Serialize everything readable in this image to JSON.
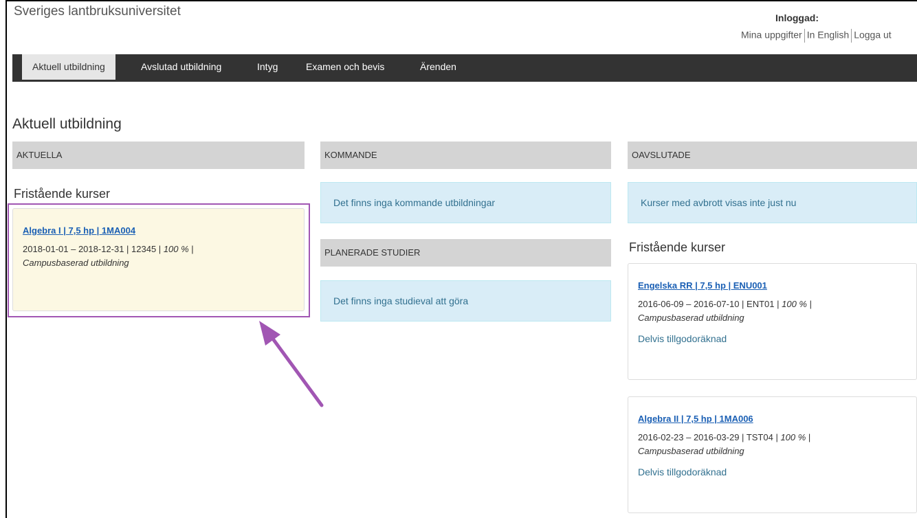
{
  "header": {
    "site_name": "Sveriges lantbruksuniversitet",
    "login_label": "Inloggad:",
    "links": [
      "Mina uppgifter",
      "In English",
      "Logga ut"
    ]
  },
  "nav": {
    "items": [
      {
        "label": "Aktuell utbildning",
        "active": true
      },
      {
        "label": "Avslutad utbildning",
        "active": false
      },
      {
        "label": "Intyg",
        "active": false
      },
      {
        "label": "Examen och bevis",
        "active": false
      },
      {
        "label": "Ärenden",
        "active": false
      }
    ]
  },
  "page": {
    "title": "Aktuell utbildning"
  },
  "columns": {
    "aktuella": {
      "header": "AKTUELLA",
      "section": "Fristående kurser",
      "courses": [
        {
          "title": "Algebra I | 7,5 hp | 1MA004",
          "meta_plain": "2018-01-01 – 2018-12-31 | 12345 | ",
          "pace": "100 %",
          "form": "Campusbaserad utbildning"
        }
      ]
    },
    "kommande": {
      "header": "KOMMANDE",
      "empty_message": "Det finns inga kommande utbildningar",
      "planned_header": "PLANERADE STUDIER",
      "planned_message": "Det finns inga studieval att göra"
    },
    "oavslutade": {
      "header": "OAVSLUTADE",
      "info_message": "Kurser med avbrott visas inte just nu",
      "section": "Fristående kurser",
      "courses": [
        {
          "title": "Engelska RR | 7,5 hp | ENU001",
          "meta_plain": "2016-06-09 – 2016-07-10 | ENT01 | ",
          "pace": "100 %",
          "form": "Campusbaserad utbildning",
          "status": "Delvis tillgodoräknad"
        },
        {
          "title": "Algebra II | 7,5 hp | 1MA006",
          "meta_plain": "2016-02-23 – 2016-03-29 | TST04 | ",
          "pace": "100 %",
          "form": "Campusbaserad utbildning",
          "status": "Delvis tillgodoräknad"
        }
      ]
    }
  },
  "colors": {
    "navbar": "#333333",
    "header_band": "#d4d4d4",
    "info_bg": "#d9edf7",
    "highlight_card": "#fcf8e3",
    "annotation": "#a156b3",
    "link": "#1a5fb4"
  }
}
